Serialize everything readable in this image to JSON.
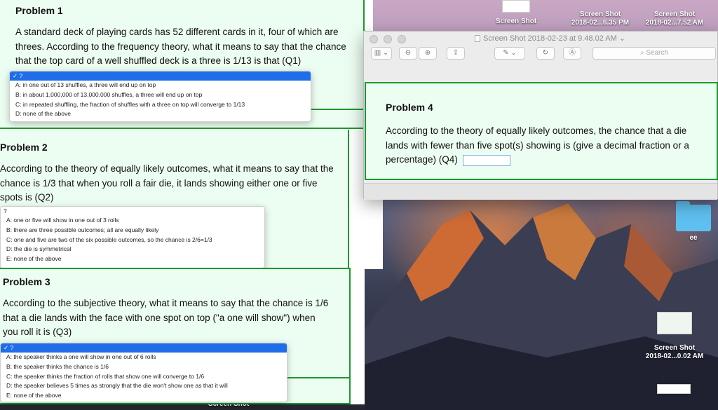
{
  "desktop": {
    "icons": [
      {
        "line1": "Screen Shot",
        "line2": ""
      },
      {
        "line1": "Screen Shot",
        "line2": "2018-02...6.35 PM"
      },
      {
        "line1": "Screen Shot",
        "line2": "2018-02...7.52 AM"
      },
      {
        "line1": "ee",
        "line2": ""
      },
      {
        "line1": "Screen Shot",
        "line2": "2018-02...0.02 AM"
      },
      {
        "line1": "Screen Shot",
        "line2": ""
      }
    ]
  },
  "problem1": {
    "title": "Problem 1",
    "text": "A standard deck of playing cards has 52 different cards in it, four of which are threes. According to the frequency theory, what it means to say that the chance that the top card of a well shuffled deck is a three is 1/13 is that (Q1)",
    "selected": "✓ ?",
    "options": [
      "A: in one out of 13 shuffles, a three will end up on top",
      "B: in about 1,000,000 of 13,000,000 shuffles, a three will end up on top",
      "C: in repeated shuffling, the fraction of shuffles with a three on top will converge to 1/13",
      "D: none of the above"
    ]
  },
  "problem2": {
    "title": "Problem 2",
    "text": "According to the theory of equally likely outcomes, what it means to say that the chance is 1/3 that when you roll a fair die, it lands showing either one or five spots is (Q2)",
    "selected": "?",
    "options": [
      "A: one or five will show in one out of 3 rolls",
      "B: there are three possible outcomes; all are equally likely",
      "C: one and five are two of the six possible outcomes, so the chance is 2/6=1/3",
      "D: the die is symmetrical",
      "E: none of the above"
    ]
  },
  "problem3": {
    "title": "Problem 3",
    "text": "According to the subjective theory, what it means to say that the chance is 1/6 that a die lands with the face with one spot on top (\"a one will show\") when you roll it is (Q3)",
    "selected": "✓ ?",
    "options": [
      "A: the speaker thinks a one will show in one out of 6 rolls",
      "B: the speaker thinks the chance is 1/6",
      "C: the speaker thinks the fraction of rolls that show one will converge to 1/6",
      "D: the speaker believes 5 times as strongly that the die won't show one as that it will",
      "E: none of the above"
    ]
  },
  "preview": {
    "title": "Screen Shot 2018-02-23 at 9.48.02 AM",
    "search_placeholder": "Search",
    "problem4": {
      "title": "Problem 4",
      "text": "According to the theory of equally likely outcomes, the chance that a die lands with fewer than five spot(s) showing is (give a decimal fraction or a percentage) (Q4)",
      "answer": ""
    }
  }
}
